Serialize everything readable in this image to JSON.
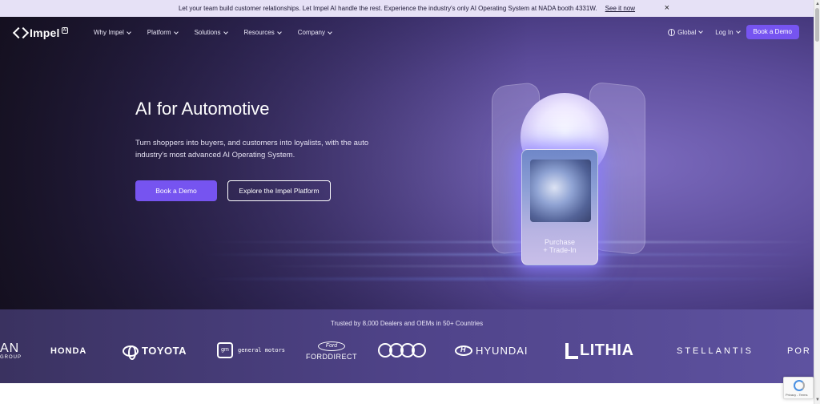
{
  "announcement": {
    "message": "Let your team build customer relationships. Let Impel AI handle the rest. Experience the industry's only AI Operating System at NADA booth 4331W.",
    "link": "See it now",
    "close": "×"
  },
  "nav": {
    "logo_text": "Impel",
    "logo_badge": "AI",
    "items": [
      {
        "label": "Why Impel"
      },
      {
        "label": "Platform"
      },
      {
        "label": "Solutions"
      },
      {
        "label": "Resources"
      },
      {
        "label": "Company"
      }
    ],
    "global": "Global",
    "login": "Log In",
    "cta": "Book a Demo"
  },
  "hero": {
    "title": "AI for Automotive",
    "subtitle": "Turn shoppers into buyers, and customers into loyalists, with the auto industry's most advanced AI Operating System.",
    "primary_button": "Book a Demo",
    "secondary_button": "Explore the Impel Platform",
    "card_label_1": "Purchase",
    "card_label_2": "+ Trade-In"
  },
  "trusted": {
    "title": "Trusted by 8,000 Dealers and OEMs in 50+ Countries",
    "logos": {
      "nissan": "AN",
      "nissan_sub": "GROUP",
      "honda": "HONDA",
      "toyota": "TOYOTA",
      "gm_box": "gm",
      "gm": "general motors",
      "ford_oval": "Ford",
      "ford": "FORDDIRECT",
      "hyundai": "HYUNDAI",
      "lithia": "LITHIA",
      "stellantis": "STELLANTIS",
      "porsche": "POR"
    }
  },
  "recaptcha": {
    "text": "Privacy - Terms"
  },
  "colors": {
    "accent": "#7654f0",
    "announcement_bg": "#e6e1f6",
    "hero_dark": "#17131f",
    "hero_purple": "#5c4f9a"
  }
}
